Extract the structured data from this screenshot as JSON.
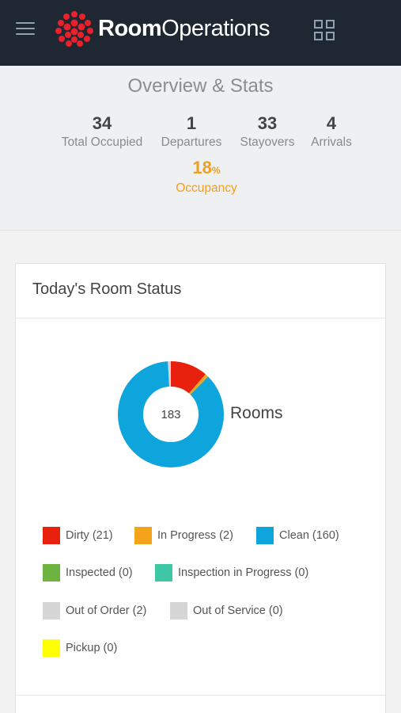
{
  "app": {
    "brand_bold": "Room",
    "brand_light": "Operations",
    "menu_icon": "hamburger-icon",
    "apps_icon": "grid-icon",
    "colors": {
      "topbar": "#1e2732",
      "logo": "#e8212b",
      "accent": "#f29e1e"
    }
  },
  "overview": {
    "title": "Overview & Stats",
    "stats": [
      {
        "value": "34",
        "label": "Total Occupied"
      },
      {
        "value": "1",
        "label": "Departures"
      },
      {
        "value": "33",
        "label": "Stayovers"
      },
      {
        "value": "4",
        "label": "Arrivals"
      }
    ],
    "occupancy_value": "18",
    "occupancy_unit": "%",
    "occupancy_label": "Occupancy"
  },
  "room_status": {
    "title": "Today's Room Status",
    "total": "183",
    "total_label": "Rooms",
    "segments": [
      {
        "label": "Dirty (21)",
        "count": 21,
        "color": "#e8210f"
      },
      {
        "label": "In Progress (2)",
        "count": 2,
        "color": "#f5a31a"
      },
      {
        "label": "Clean (160)",
        "count": 160,
        "color": "#0ea5dc"
      },
      {
        "label": "Inspected (0)",
        "count": 0,
        "color": "#6db33f"
      },
      {
        "label": "Inspection in Progress (0)",
        "count": 0,
        "color": "#3ec7a4"
      },
      {
        "label": "Out of Order (2)",
        "count": 2,
        "color": "#d6d6d6"
      },
      {
        "label": "Out of Service (0)",
        "count": 0,
        "color": "#d6d6d6"
      },
      {
        "label": "Pickup (0)",
        "count": 0,
        "color": "#ffff00"
      }
    ]
  }
}
